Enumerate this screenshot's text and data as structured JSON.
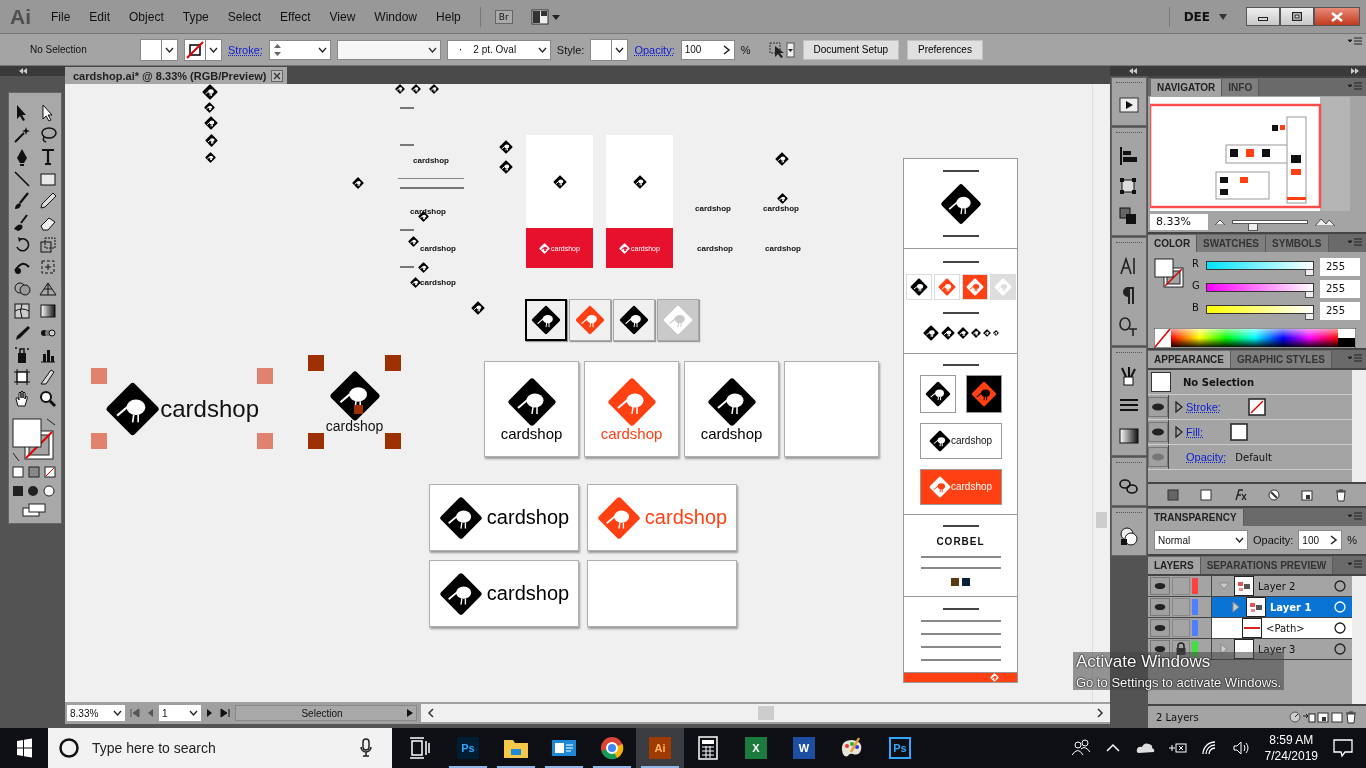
{
  "app": {
    "logo": "Ai",
    "menu": [
      "File",
      "Edit",
      "Object",
      "Type",
      "Select",
      "Effect",
      "View",
      "Window",
      "Help"
    ],
    "bridge": "Br",
    "workspace": "DEE"
  },
  "control_bar": {
    "selection": "No Selection",
    "stroke_label": "Stroke:",
    "brush_dot": "·",
    "brush": "2 pt. Oval",
    "style_label": "Style:",
    "opacity_label": "Opacity:",
    "opacity": "100",
    "percent": "%",
    "buttons": [
      "Document Setup",
      "Preferences"
    ]
  },
  "document": {
    "tab": "cardshop.ai* @ 8.33% (RGB/Preview)",
    "sketch_labels": [
      "cardshop",
      "cardshop",
      "cardshop",
      "cardshop",
      "cardshop",
      "cardshop",
      "cardshop",
      "cardshop"
    ],
    "mini_cards": [
      {
        "text": "cardshop",
        "color": "#e8112d"
      },
      {
        "text": "cardshop",
        "color": "#e8112d"
      }
    ],
    "logo_tiles": [
      {
        "kind": "outlined",
        "color": "#000000"
      },
      {
        "kind": "plain",
        "color": "#ff4013"
      },
      {
        "kind": "plain",
        "color": "#000000"
      },
      {
        "kind": "shaded",
        "color": "#ffffff"
      }
    ],
    "selected_logos": [
      {
        "kind": "horizontal",
        "text": "cardshop",
        "color": "#e0826e"
      },
      {
        "kind": "stacked",
        "text": "cardshop",
        "color": "#9c3000"
      }
    ],
    "cards_large": [
      {
        "kind": "logo",
        "text": "cardshop",
        "color": "#000000"
      },
      {
        "kind": "logo",
        "text": "cardshop",
        "color": "#ff4013"
      },
      {
        "kind": "logo",
        "text": "cardshop",
        "color": "#000000"
      },
      {
        "kind": "blank"
      }
    ],
    "cards_wide": [
      {
        "kind": "logo",
        "text": "cardshop",
        "color": "#000000"
      },
      {
        "kind": "logo",
        "text": "cardshop",
        "color": "#ff4013"
      },
      {
        "kind": "logo",
        "text": "cardshop",
        "color": "#000000"
      },
      {
        "kind": "blank"
      }
    ],
    "brand_sheet": {
      "labels": [
        "cardshop",
        "cardshop"
      ],
      "typeface": "CORBEL"
    }
  },
  "status": {
    "zoom": "8.33%",
    "artboard": "1",
    "tool": "Selection"
  },
  "navigator": {
    "tabs": [
      {
        "label": "NAVIGATOR",
        "selected": true
      },
      {
        "label": "INFO",
        "selected": false
      }
    ],
    "zoom": "8.33%",
    "level": 0.25
  },
  "color": {
    "tabs": [
      {
        "label": "COLOR",
        "selected": true
      },
      {
        "label": "SWATCHES",
        "selected": false
      },
      {
        "label": "SYMBOLS",
        "selected": false
      }
    ],
    "channels": [
      {
        "name": "R",
        "value": "255",
        "level": 1
      },
      {
        "name": "G",
        "value": "255",
        "level": 1
      },
      {
        "name": "B",
        "value": "255",
        "level": 1
      }
    ]
  },
  "appearance": {
    "tabs": [
      {
        "label": "APPEARANCE",
        "selected": true
      },
      {
        "label": "GRAPHIC STYLES",
        "selected": false
      }
    ],
    "title": "No Selection",
    "rows": [
      {
        "kind": "stroke",
        "label": "Stroke:"
      },
      {
        "kind": "fill",
        "label": "Fill:"
      },
      {
        "kind": "opacity",
        "label": "Opacity:",
        "value": "Default"
      }
    ]
  },
  "transparency": {
    "title": "TRANSPARENCY",
    "mode": "Normal",
    "opacity_label": "Opacity:",
    "opacity": "100",
    "percent": "%"
  },
  "layers": {
    "tabs": [
      {
        "label": "LAYERS",
        "selected": true
      },
      {
        "label": "SEPARATIONS PREVIEW",
        "selected": false
      }
    ],
    "tree": [
      {
        "name": "Layer 2",
        "color": "#ff4040",
        "expanded": true,
        "locked": false,
        "selected": false,
        "children": [
          {
            "name": "Layer 1",
            "color": "#4f7fff",
            "expanded": false,
            "locked": false,
            "selected": true
          },
          {
            "name": "<Path>",
            "color": "#4f7fff",
            "kind": "path",
            "locked": false,
            "selected": false
          }
        ]
      },
      {
        "name": "Layer 3",
        "color": "#40e040",
        "expanded": false,
        "locked": true,
        "selected": false
      }
    ],
    "footer": "2 Layers"
  },
  "taskbar": {
    "search_placeholder": "Type here to search",
    "apps": [
      {
        "kind": "ps",
        "label": "Ps",
        "running": true,
        "active": false
      },
      {
        "kind": "folder",
        "running": true,
        "active": false
      },
      {
        "kind": "mail",
        "running": true,
        "active": false
      },
      {
        "kind": "chrome",
        "running": true,
        "active": false
      },
      {
        "kind": "ai",
        "label": "Ai",
        "running": true,
        "active": true
      },
      {
        "kind": "calculator",
        "running": false,
        "active": false
      },
      {
        "kind": "excel",
        "label": "X",
        "running": false,
        "active": false
      },
      {
        "kind": "word",
        "label": "W",
        "running": false,
        "active": false
      },
      {
        "kind": "paint",
        "running": false,
        "active": false
      },
      {
        "kind": "ps2",
        "label": "Ps",
        "running": false,
        "active": false
      }
    ],
    "time": "8:59 AM",
    "date": "7/24/2019"
  },
  "os_notice": [
    "Activate Windows",
    "Go to Settings to activate Windows."
  ]
}
